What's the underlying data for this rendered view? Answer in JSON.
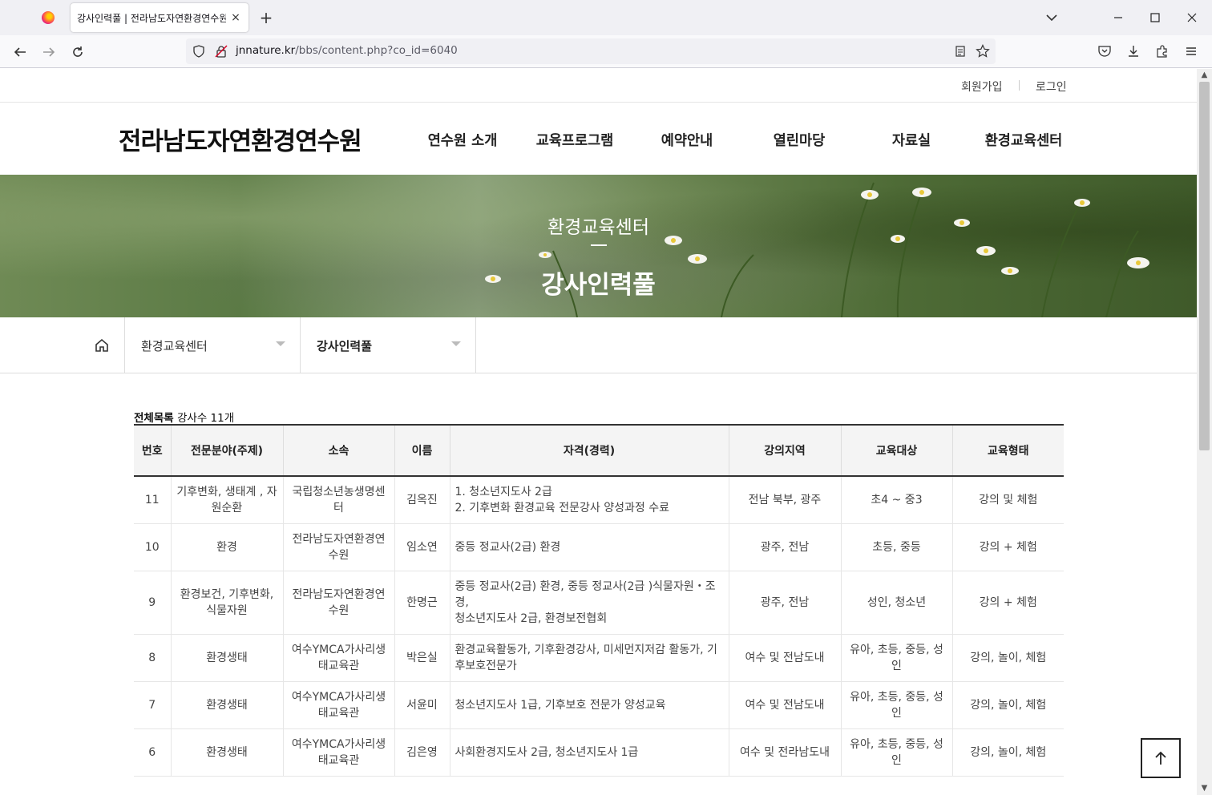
{
  "browser": {
    "tab_title": "강사인력풀 | 전라남도자연환경연수원",
    "tab_close": "×",
    "new_tab": "+",
    "url_host": "jnnature.kr",
    "url_path": "/bbs/content.php?co_id=6040"
  },
  "util": {
    "signup": "회원가입",
    "login": "로그인"
  },
  "site": {
    "logo": "전라남도자연환경연수원"
  },
  "gnb": [
    "연수원 소개",
    "교육프로그램",
    "예약안내",
    "열린마당",
    "자료실",
    "환경교육센터"
  ],
  "hero": {
    "subtitle": "환경교육센터",
    "title": "강사인력풀"
  },
  "subnav": {
    "depth1": "환경교육센터",
    "depth2": "강사인력풀"
  },
  "list": {
    "count_label": "전체목록",
    "count_text": "강사수 11개"
  },
  "table": {
    "headers": [
      "번호",
      "전문분야(주제)",
      "소속",
      "이름",
      "자격(경력)",
      "강의지역",
      "교육대상",
      "교육형태"
    ],
    "rows": [
      [
        "11",
        "기후변화, 생태계 , 자원순환",
        "국립청소년농생명센터",
        "김옥진",
        "1. 청소년지도사 2급\n2. 기후변화 환경교육 전문강사 양성과정 수료",
        "전남 북부, 광주",
        "초4 ~ 중3",
        "강의 및 체험"
      ],
      [
        "10",
        "환경",
        "전라남도자연환경연수원",
        "임소연",
        "중등 정교사(2급) 환경",
        "광주, 전남",
        "초등, 중등",
        "강의 + 체험"
      ],
      [
        "9",
        "환경보건, 기후변화, 식물자원",
        "전라남도자연환경연수원",
        "한명근",
        "중등 정교사(2급) 환경, 중등 정교사(2급 )식물자원・조경,\n청소년지도사 2급, 환경보전협회",
        "광주, 전남",
        "성인, 청소년",
        "강의 + 체험"
      ],
      [
        "8",
        "환경생태",
        "여수YMCA가사리생태교육관",
        "박은실",
        "환경교육활동가, 기후환경강사, 미세먼지저감 활동가, 기후보호전문가",
        "여수 및 전남도내",
        "유아, 초등, 중등, 성인",
        "강의, 놀이, 체험"
      ],
      [
        "7",
        "환경생태",
        "여수YMCA가사리생태교육관",
        "서윤미",
        "청소년지도사 1급, 기후보호 전문가 양성교육",
        "여수 및 전남도내",
        "유아, 초등, 중등, 성인",
        "강의, 놀이, 체험"
      ],
      [
        "6",
        "환경생태",
        "여수YMCA가사리생태교육관",
        "김은영",
        "사회환경지도사 2급, 청소년지도사 1급",
        "여수 및 전라남도내",
        "유아, 초등, 중등, 성인",
        "강의, 놀이, 체험"
      ]
    ]
  },
  "icons": {
    "back": "arrow-left-icon",
    "forward": "arrow-right-icon",
    "reload": "reload-icon",
    "home": "home-icon",
    "top": "arrow-up-icon"
  },
  "colors": {
    "text": "#222222",
    "header_border": "#333333",
    "hero_green": "#5b7a45"
  }
}
